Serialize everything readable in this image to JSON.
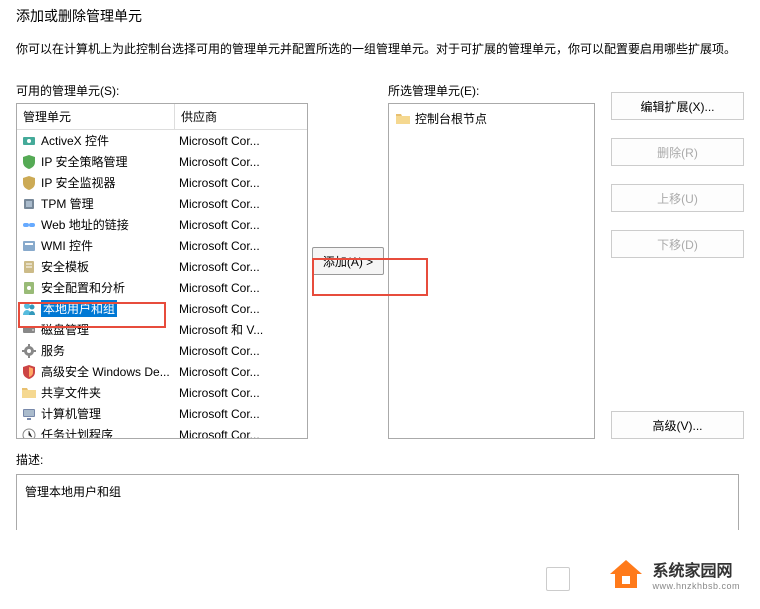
{
  "dialog": {
    "title": "添加或删除管理单元",
    "description": "你可以在计算机上为此控制台选择可用的管理单元并配置所选的一组管理单元。对于可扩展的管理单元，你可以配置要启用哪些扩展项。"
  },
  "available": {
    "label": "可用的管理单元(S):",
    "columns": {
      "name": "管理单元",
      "vendor": "供应商"
    },
    "items": [
      {
        "name": "ActiveX 控件",
        "vendor": "Microsoft Cor...",
        "icon": "activex"
      },
      {
        "name": "IP 安全策略管理",
        "vendor": "Microsoft Cor...",
        "icon": "shield-g"
      },
      {
        "name": "IP 安全监视器",
        "vendor": "Microsoft Cor...",
        "icon": "shield-y"
      },
      {
        "name": "TPM 管理",
        "vendor": "Microsoft Cor...",
        "icon": "chip"
      },
      {
        "name": "Web 地址的链接",
        "vendor": "Microsoft Cor...",
        "icon": "link"
      },
      {
        "name": "WMI 控件",
        "vendor": "Microsoft Cor...",
        "icon": "wmi"
      },
      {
        "name": "安全模板",
        "vendor": "Microsoft Cor...",
        "icon": "template"
      },
      {
        "name": "安全配置和分析",
        "vendor": "Microsoft Cor...",
        "icon": "config"
      },
      {
        "name": "本地用户和组",
        "vendor": "Microsoft Cor...",
        "icon": "users",
        "selected": true
      },
      {
        "name": "磁盘管理",
        "vendor": "Microsoft 和 V...",
        "icon": "disk"
      },
      {
        "name": "服务",
        "vendor": "Microsoft Cor...",
        "icon": "gear"
      },
      {
        "name": "高级安全 Windows De...",
        "vendor": "Microsoft Cor...",
        "icon": "firewall"
      },
      {
        "name": "共享文件夹",
        "vendor": "Microsoft Cor...",
        "icon": "folder"
      },
      {
        "name": "计算机管理",
        "vendor": "Microsoft Cor...",
        "icon": "computer"
      },
      {
        "name": "任务计划程序",
        "vendor": "Microsoft Cor...",
        "icon": "clock"
      }
    ]
  },
  "selected": {
    "label": "所选管理单元(E):",
    "root": "控制台根节点"
  },
  "buttons": {
    "add": "添加(A) >",
    "edit_ext": "编辑扩展(X)...",
    "remove": "删除(R)",
    "move_up": "上移(U)",
    "move_down": "下移(D)",
    "advanced": "高级(V)..."
  },
  "description": {
    "label": "描述:",
    "text": "管理本地用户和组"
  },
  "branding": {
    "name": "系统家园网",
    "url": "www.hnzkhbsb.com"
  }
}
